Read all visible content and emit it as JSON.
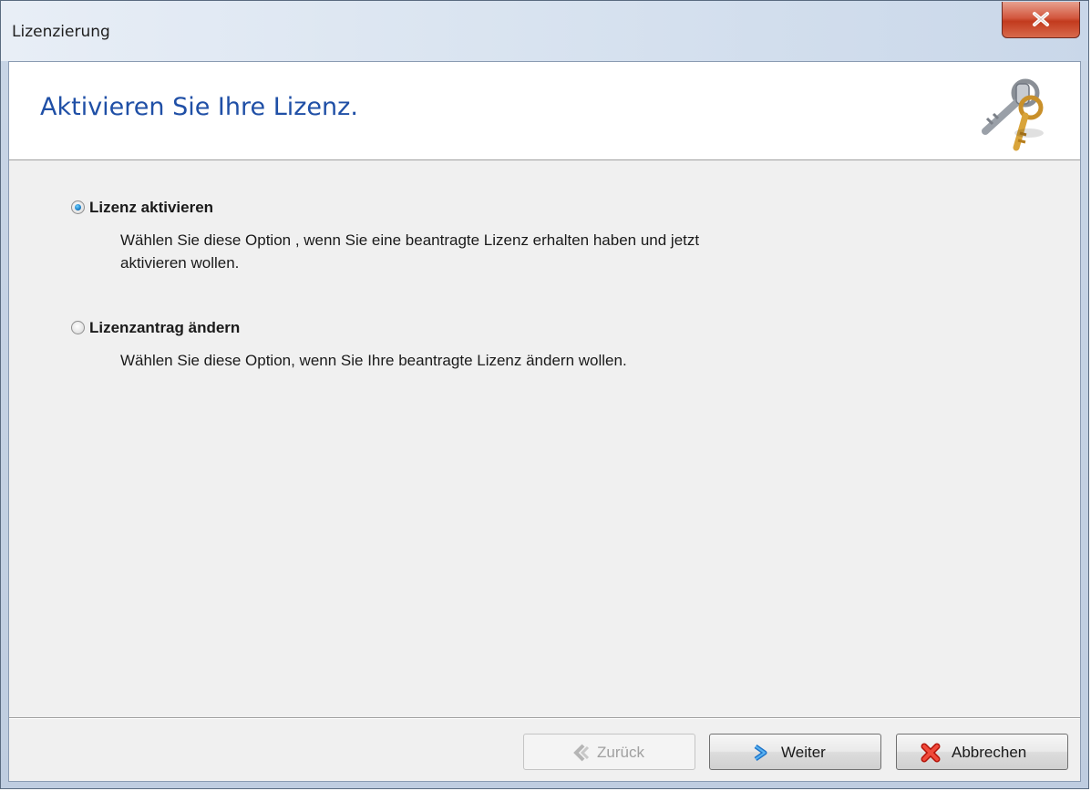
{
  "window": {
    "title": "Lizenzierung",
    "close_label": "X"
  },
  "header": {
    "title": "Aktivieren Sie Ihre Lizenz.",
    "icon": "keys-icon"
  },
  "options": [
    {
      "label": "Lizenz aktivieren",
      "selected": true,
      "description_lines": [
        "Wählen Sie diese Option , wenn Sie eine beantragte Lizenz erhalten haben und jetzt",
        "aktivieren wollen."
      ]
    },
    {
      "label": "Lizenzantrag ändern",
      "selected": false,
      "description_lines": [
        "Wählen Sie diese Option, wenn Sie Ihre beantragte Lizenz ändern wollen."
      ]
    }
  ],
  "buttons": {
    "back": {
      "label": "Zurück",
      "enabled": false,
      "icon": "back-chevron-icon"
    },
    "next": {
      "label": "Weiter",
      "enabled": true,
      "icon": "next-chevron-icon"
    },
    "cancel": {
      "label": "Abbrechen",
      "enabled": true,
      "icon": "cancel-x-icon"
    }
  }
}
